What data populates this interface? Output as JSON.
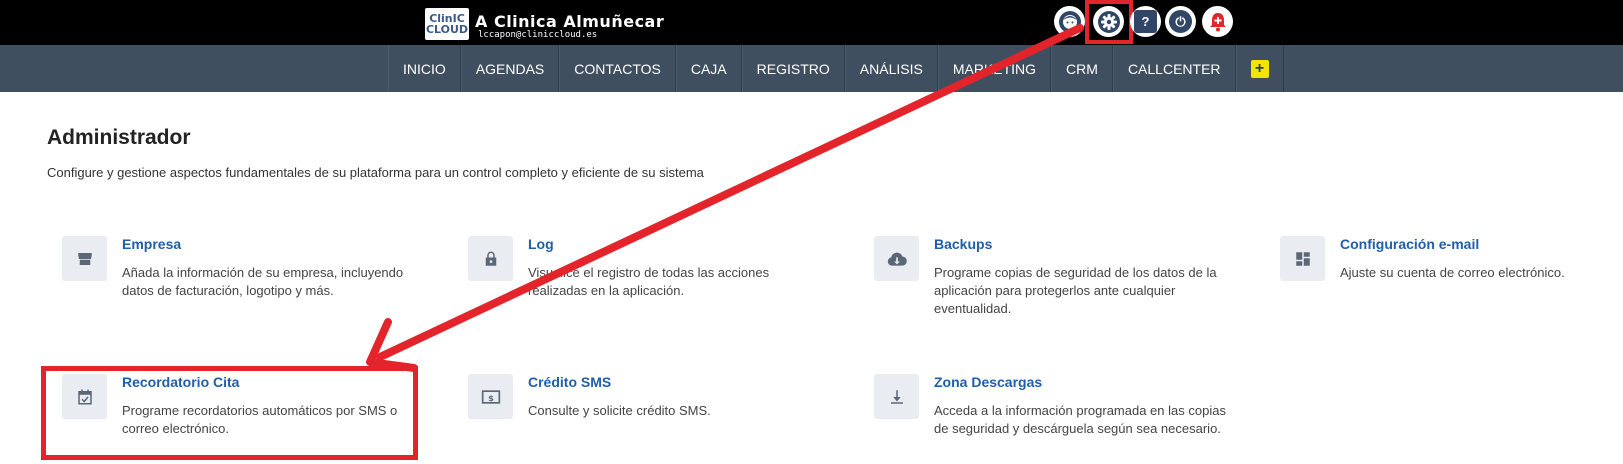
{
  "brand": {
    "logo_line1": "ClinIC",
    "logo_line2": "CLOUD",
    "title": "A Clinica Almuñecar",
    "email": "lccapon@cliniccloud.es"
  },
  "top_icons": {
    "profile": "avatar-icon",
    "settings": "gear-icon",
    "help": "help-icon",
    "help_glyph": "?",
    "power": "power-icon",
    "power_glyph": "⏻",
    "notifications": "bell-icon"
  },
  "nav": {
    "items": [
      "INICIO",
      "AGENDAS",
      "CONTACTOS",
      "CAJA",
      "REGISTRO",
      "ANÁLISIS",
      "MARKETING",
      "CRM",
      "CALLCENTER"
    ],
    "plus": "+"
  },
  "page": {
    "title": "Administrador",
    "description": "Configure y gestione aspectos fundamentales de su plataforma para un control completo y eficiente de su sistema"
  },
  "cards": [
    {
      "title": "Empresa",
      "desc": "Añada la información de su empresa, incluyendo datos de facturación, logotipo y más.",
      "icon": "store-icon"
    },
    {
      "title": "Log",
      "desc": "Visualice el registro de todas las acciones realizadas en la aplicación.",
      "icon": "lock-icon"
    },
    {
      "title": "Backups",
      "desc": "Programe copias de seguridad de los datos de la aplicación para protegerlos ante cualquier eventualidad.",
      "icon": "cloud-download-icon"
    },
    {
      "title": "Configuración e-mail",
      "desc": "Ajuste su cuenta de correo electrónico.",
      "icon": "dashboard-icon"
    },
    {
      "title": "Recordatorio Cita",
      "desc": "Programe recordatorios automáticos por SMS o correo electrónico.",
      "icon": "calendar-check-icon"
    },
    {
      "title": "Crédito SMS",
      "desc": "Consulte y solicite crédito SMS.",
      "icon": "money-icon"
    },
    {
      "title": "Zona Descargas",
      "desc": "Acceda a la información programada en las copias de seguridad y descárguela según sea necesario.",
      "icon": "download-icon"
    }
  ],
  "colors": {
    "accent_link": "#1f5ea8",
    "annotation_red": "#e3242b",
    "navbar": "#3f4f60",
    "topbar": "#000000",
    "plus_yellow": "#f5e400"
  }
}
